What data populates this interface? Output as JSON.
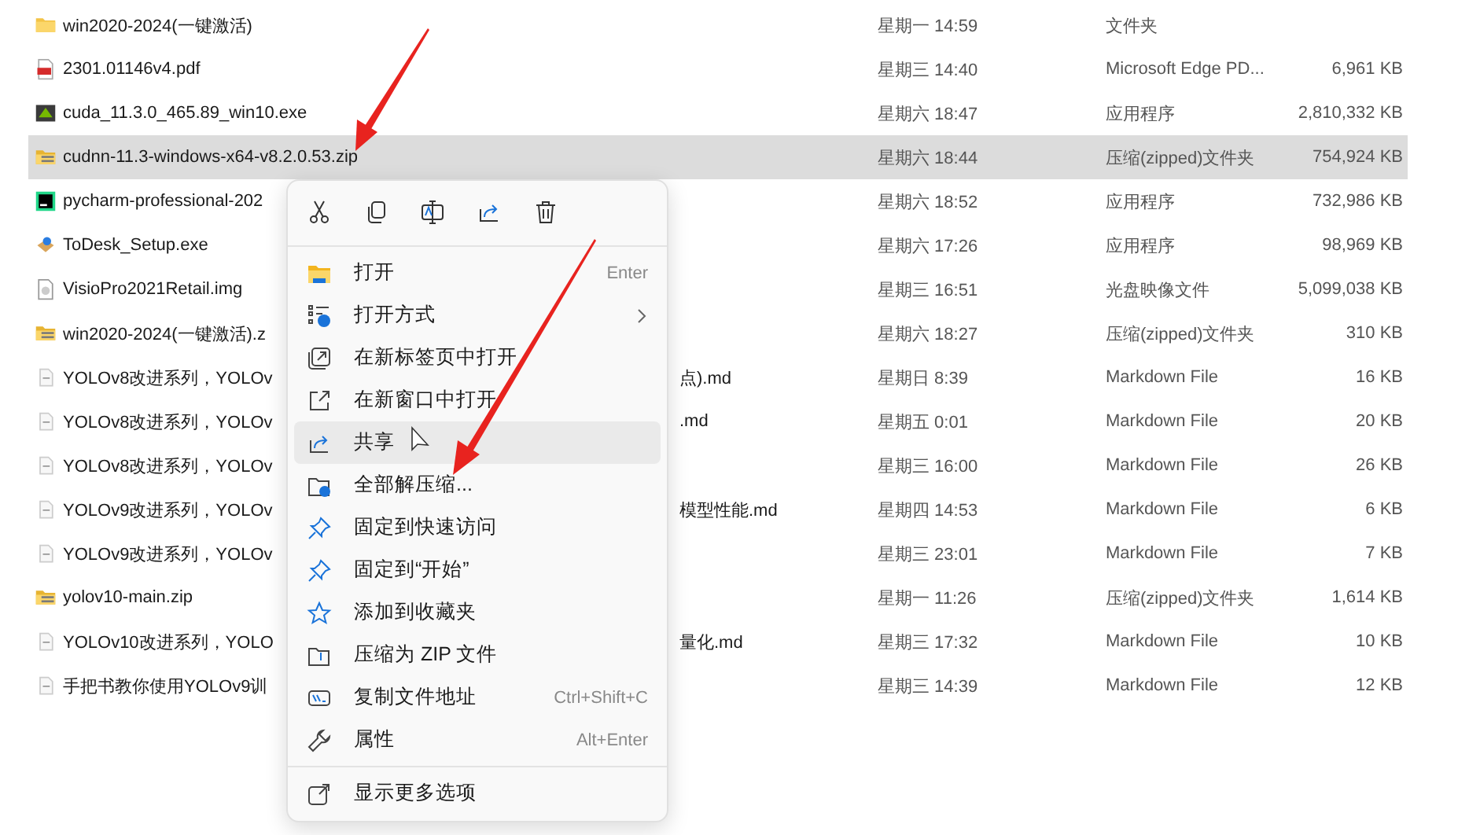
{
  "files": [
    {
      "name": "win2020-2024(一键激活)",
      "kind": "folder",
      "date": "星期一 14:59",
      "type": "文件夹",
      "selected": false
    },
    {
      "name": "2301.01146v4.pdf",
      "kind": "pdf",
      "date": "星期三 14:40",
      "type": "Microsoft Edge PD...",
      "size": "6,961 KB",
      "selected": false
    },
    {
      "name": "cuda_11.3.0_465.89_win10.exe",
      "kind": "gpu-app",
      "date": "星期六 18:47",
      "type": "应用程序",
      "size": "2,810,332 KB",
      "selected": false
    },
    {
      "name": "cudnn-11.3-windows-x64-v8.2.0.53.zip",
      "kind": "zip",
      "date": "星期六 18:44",
      "type": "压缩(zipped)文件夹",
      "size": "754,924 KB",
      "selected": true
    },
    {
      "name": "pycharm-professional-202",
      "kind": "ide-app",
      "date": "星期六 18:52",
      "type": "应用程序",
      "size": "732,986 KB",
      "selected": false
    },
    {
      "name": "ToDesk_Setup.exe",
      "kind": "installer",
      "date": "星期六 17:26",
      "type": "应用程序",
      "size": "98,969 KB",
      "selected": false
    },
    {
      "name": "VisioPro2021Retail.img",
      "kind": "disc",
      "date": "星期三 16:51",
      "type": "光盘映像文件",
      "size": "5,099,038 KB",
      "selected": false
    },
    {
      "name": "win2020-2024(一键激活).z",
      "kind": "zip",
      "date": "星期六 18:27",
      "type": "压缩(zipped)文件夹",
      "size": "310 KB",
      "selected": false
    },
    {
      "name": "YOLOv8改进系列，YOLOv",
      "tail": "点).md",
      "kind": "doc",
      "date": "星期日 8:39",
      "type": "Markdown File",
      "size": "16 KB",
      "selected": false
    },
    {
      "name": "YOLOv8改进系列，YOLOv",
      "tail": ".md",
      "kind": "doc",
      "date": "星期五 0:01",
      "type": "Markdown File",
      "size": "20 KB",
      "selected": false
    },
    {
      "name": "YOLOv8改进系列，YOLOv",
      "kind": "doc",
      "date": "星期三 16:00",
      "type": "Markdown File",
      "size": "26 KB",
      "selected": false
    },
    {
      "name": "YOLOv9改进系列，YOLOv",
      "tail": "模型性能.md",
      "kind": "doc",
      "date": "星期四 14:53",
      "type": "Markdown File",
      "size": "6 KB",
      "selected": false
    },
    {
      "name": "YOLOv9改进系列，YOLOv",
      "kind": "doc",
      "date": "星期三 23:01",
      "type": "Markdown File",
      "size": "7 KB",
      "selected": false
    },
    {
      "name": "yolov10-main.zip",
      "kind": "zip",
      "date": "星期一 11:26",
      "type": "压缩(zipped)文件夹",
      "size": "1,614 KB",
      "selected": false
    },
    {
      "name": "YOLOv10改进系列，YOLO",
      "tail": "量化.md",
      "kind": "doc",
      "date": "星期三 17:32",
      "type": "Markdown File",
      "size": "10 KB",
      "selected": false
    },
    {
      "name": "手把书教你使用YOLOv9训",
      "kind": "doc",
      "date": "星期三 14:39",
      "type": "Markdown File",
      "size": "12 KB",
      "selected": false
    }
  ],
  "context_menu": {
    "toolbar": [
      {
        "kind": "cut"
      },
      {
        "kind": "copy"
      },
      {
        "kind": "rename"
      },
      {
        "kind": "share"
      },
      {
        "kind": "delete"
      }
    ],
    "items": [
      {
        "label": "打开",
        "shortcut": "Enter",
        "kind": "folder",
        "submenu": false,
        "selected": false
      },
      {
        "label": "打开方式",
        "kind": "open-with",
        "submenu": true,
        "selected": false
      },
      {
        "label": "在新标签页中打开",
        "kind": "new-tab",
        "submenu": false,
        "selected": false
      },
      {
        "label": "在新窗口中打开",
        "kind": "new-window",
        "submenu": false,
        "selected": false
      },
      {
        "label": "共享",
        "kind": "share",
        "submenu": false,
        "selected": true
      },
      {
        "label": "全部解压缩...",
        "kind": "extract",
        "submenu": false,
        "selected": false
      },
      {
        "label": "固定到快速访问",
        "kind": "pin",
        "submenu": false,
        "selected": false
      },
      {
        "label": "固定到“开始”",
        "kind": "pin",
        "submenu": false,
        "selected": false
      },
      {
        "label": "添加到收藏夹",
        "kind": "star",
        "submenu": false,
        "selected": false
      },
      {
        "label": "压缩为 ZIP 文件",
        "kind": "zip",
        "submenu": false,
        "selected": false
      },
      {
        "label": "复制文件地址",
        "shortcut": "Ctrl+Shift+C",
        "kind": "path",
        "submenu": false,
        "selected": false
      },
      {
        "label": "属性",
        "shortcut": "Alt+Enter",
        "kind": "wrench",
        "submenu": false,
        "selected": false
      }
    ],
    "footer": [
      {
        "label": "显示更多选项",
        "kind": "more",
        "submenu": false,
        "selected": false
      }
    ]
  }
}
